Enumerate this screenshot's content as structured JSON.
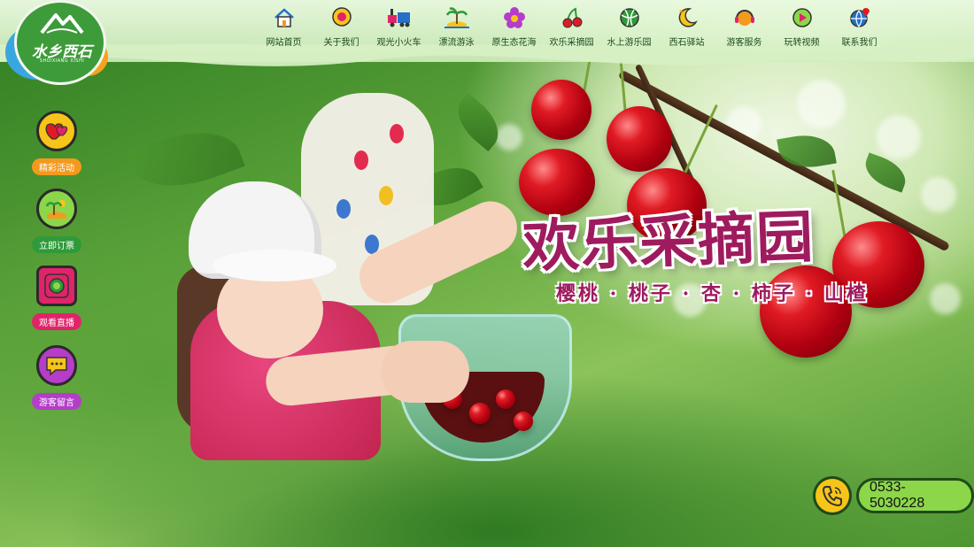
{
  "site": {
    "logo_text": "水乡西石",
    "logo_subtext": "SHUIXIANG XISHI"
  },
  "nav": [
    {
      "label": "网站首页",
      "icon": "home-icon"
    },
    {
      "label": "关于我们",
      "icon": "chat-bubble-icon"
    },
    {
      "label": "观光小火车",
      "icon": "train-icon"
    },
    {
      "label": "漂流游泳",
      "icon": "palm-island-icon"
    },
    {
      "label": "原生态花海",
      "icon": "flower-icon"
    },
    {
      "label": "欢乐采摘园",
      "icon": "cherry-icon"
    },
    {
      "label": "水上游乐园",
      "icon": "ball-icon"
    },
    {
      "label": "西石驿站",
      "icon": "moon-icon"
    },
    {
      "label": "游客服务",
      "icon": "headset-icon"
    },
    {
      "label": "玩转视频",
      "icon": "play-icon"
    },
    {
      "label": "联系我们",
      "icon": "globe-pin-icon"
    }
  ],
  "side_buttons": [
    {
      "label": "精彩活动",
      "icon": "hearts-icon",
      "color": "#f39a1e"
    },
    {
      "label": "立即订票",
      "icon": "island-icon",
      "color": "#2f9a3a"
    },
    {
      "label": "观看直播",
      "icon": "live-camera-icon",
      "color": "#e0246a"
    },
    {
      "label": "游客留言",
      "icon": "message-icon",
      "color": "#b53dc9"
    }
  ],
  "hero": {
    "headline": "欢乐采摘园",
    "subline": "樱桃 · 桃子 · 杏 · 柿子 · 山楂"
  },
  "phone": {
    "number": "0533-5030228",
    "icon": "phone-icon"
  },
  "colors": {
    "headline": "#9e1b5e",
    "nav_text": "#1c4a20",
    "phone_pill": "#8cd64a"
  }
}
